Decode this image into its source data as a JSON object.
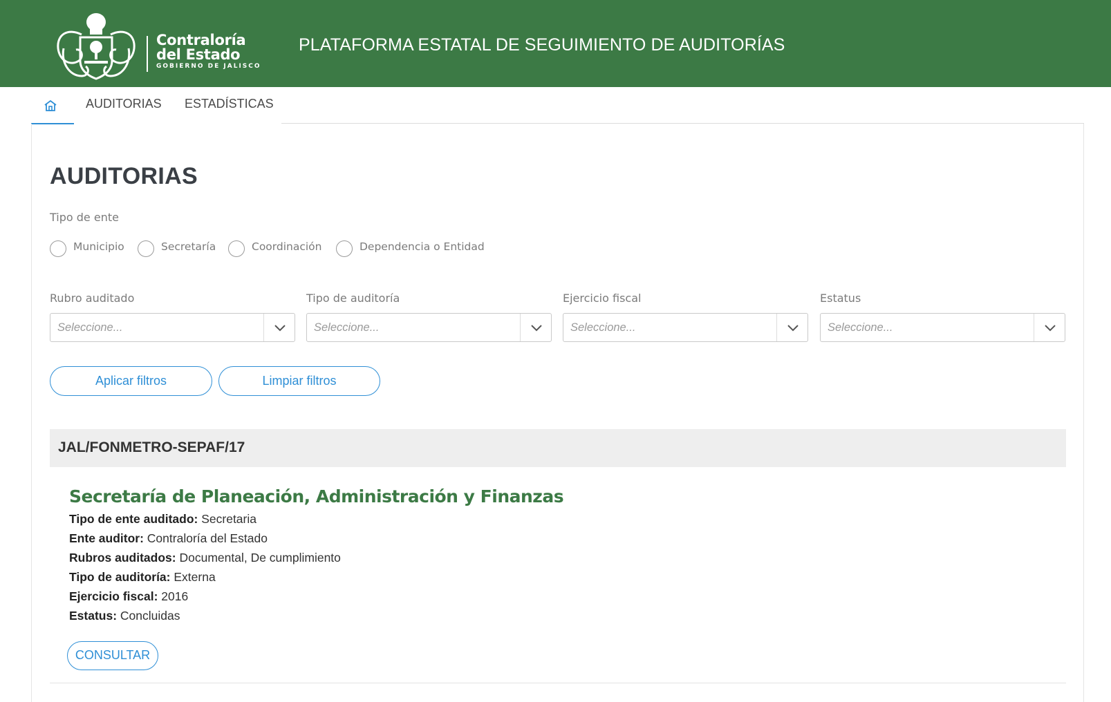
{
  "header": {
    "logo": {
      "line1": "Contraloría",
      "line2": "del Estado",
      "line3": "GOBIERNO DE JALISCO",
      "icon": "jalisco-coat-of-arms-icon"
    },
    "title": "PLATAFORMA ESTATAL DE SEGUIMIENTO DE AUDITORÍAS",
    "background_color": "#3c7a45"
  },
  "tabs": {
    "home_icon": "home-icon",
    "items": [
      {
        "label": "AUDITORIAS"
      },
      {
        "label": "ESTADÍSTICAS"
      }
    ],
    "active": "home",
    "accent_color": "#2f8fd6"
  },
  "main": {
    "title": "AUDITORIAS",
    "tipo_ente": {
      "label": "Tipo de ente",
      "options": [
        "Municipio",
        "Secretaría",
        "Coordinación",
        "Dependencia o Entidad"
      ]
    },
    "filters": [
      {
        "label": "Rubro auditado",
        "placeholder": "Seleccione..."
      },
      {
        "label": "Tipo de auditoría",
        "placeholder": "Seleccione..."
      },
      {
        "label": "Ejercicio fiscal",
        "placeholder": "Seleccione..."
      },
      {
        "label": "Estatus",
        "placeholder": "Seleccione..."
      }
    ],
    "buttons": {
      "apply": "Aplicar filtros",
      "clear": "Limpiar filtros"
    }
  },
  "results": [
    {
      "code": "JAL/FONMETRO-SEPAF/17",
      "entity": "Secretaría de Planeación, Administración y Finanzas",
      "fields": [
        {
          "label": "Tipo de ente auditado:",
          "value": "Secretaria"
        },
        {
          "label": "Ente auditor:",
          "value": "Contraloría del Estado"
        },
        {
          "label": "Rubros auditados:",
          "value": "Documental, De cumplimiento"
        },
        {
          "label": "Tipo de auditoría:",
          "value": "Externa"
        },
        {
          "label": "Ejercicio fiscal:",
          "value": "2016"
        },
        {
          "label": "Estatus:",
          "value": "Concluidas"
        }
      ],
      "button": "CONSULTAR"
    }
  ]
}
